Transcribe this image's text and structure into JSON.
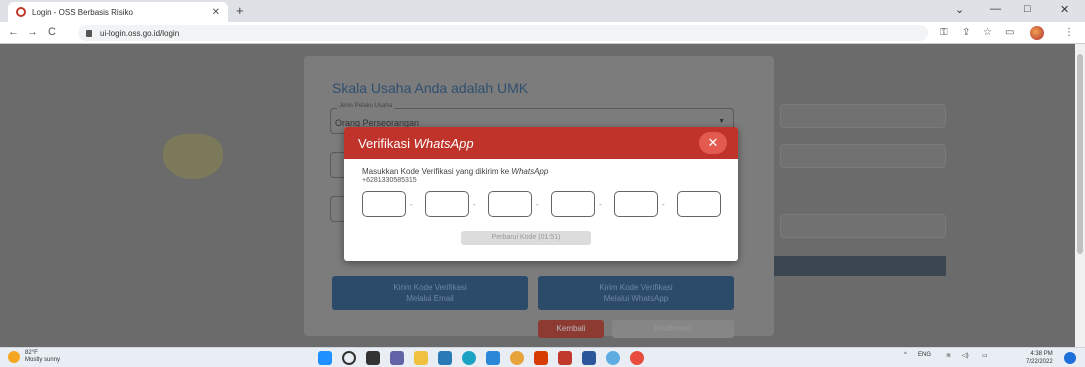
{
  "browser": {
    "tab_title": "Login - OSS Berbasis Risiko",
    "tab_close": "✕",
    "new_tab": "+",
    "url": "ui-login.oss.go.id/login",
    "win_min": "—",
    "win_restore": "□",
    "win_close": "✕",
    "win_chevron": "⌄",
    "nav_back": "←",
    "nav_forward": "→",
    "nav_reload": "C"
  },
  "modal": {
    "title": "Skala Usaha Anda adalah UMK",
    "jenis_legend": "Jenis Pelaku Usaha",
    "jenis_value": "Orang Perseorangan",
    "btn_email_line1": "Kirim Kode Verifikasi",
    "btn_email_line2": "Melalui Email",
    "btn_wa_line1": "Kirim Kode Verifikasi",
    "btn_wa_line2": "Melalui WhatsApp",
    "kembali": "Kembali",
    "konfirmasi": "Konfirmasi"
  },
  "dialog": {
    "title_prefix": "Verifikasi ",
    "title_italic": "WhatsApp",
    "close": "✕",
    "desc_prefix": "Masukkan Kode Verifikasi yang dikirim ke ",
    "desc_italic": "WhatsApp",
    "phone": "+6281330585315",
    "resend": "Perbarui Kode (01:51)",
    "otp_values": [
      "",
      "",
      "",
      "",
      "",
      ""
    ]
  },
  "taskbar": {
    "temp": "82°F",
    "weather": "Mostly sunny",
    "lang": "ENG",
    "time": "4:38 PM",
    "date": "7/22/2022"
  },
  "colors": {
    "accent_red": "#c0332a",
    "button_blue": "#2c4a6a"
  }
}
